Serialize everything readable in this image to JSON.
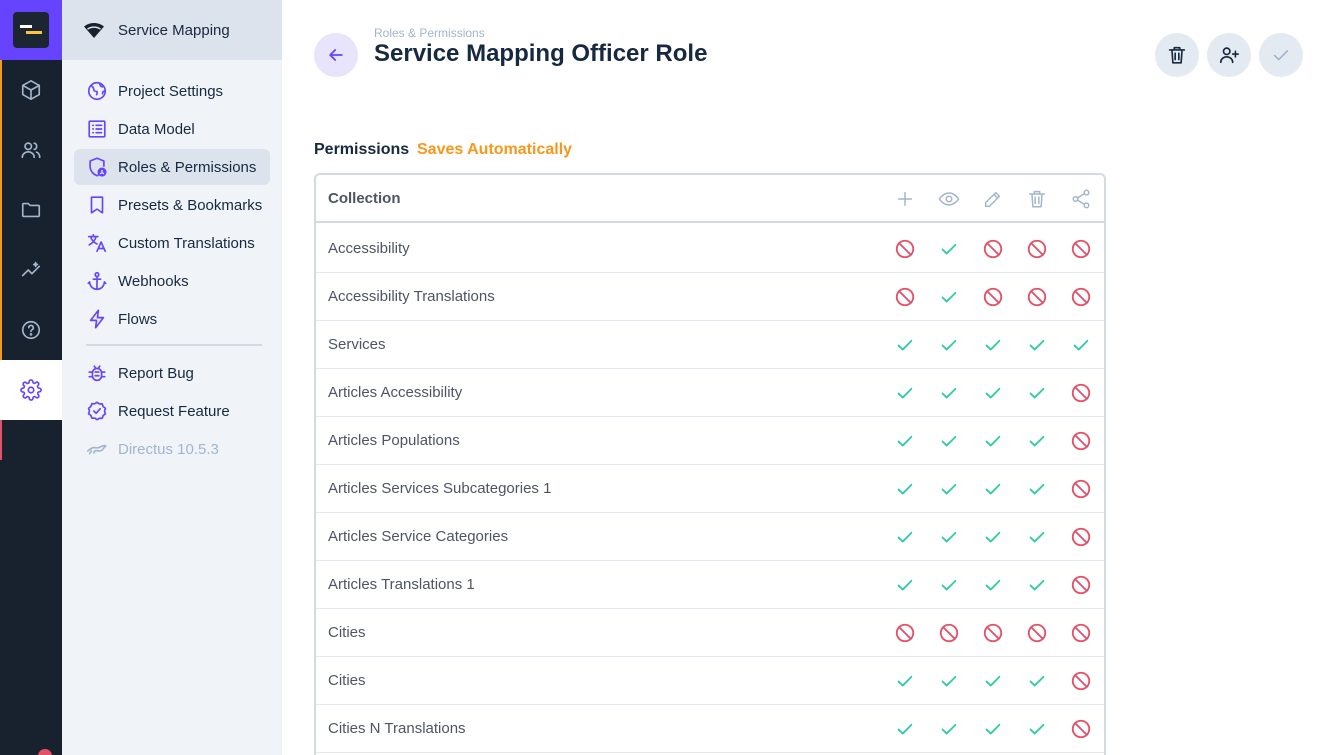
{
  "project": {
    "name": "Service Mapping"
  },
  "modules": [
    {
      "icon": "box-icon"
    },
    {
      "icon": "users-icon"
    },
    {
      "icon": "folder-icon"
    },
    {
      "icon": "insights-icon"
    },
    {
      "icon": "help-icon"
    },
    {
      "icon": "settings-icon"
    }
  ],
  "nav": {
    "items": [
      {
        "label": "Project Settings",
        "icon": "public-icon"
      },
      {
        "label": "Data Model",
        "icon": "list-alt-icon"
      },
      {
        "label": "Roles & Permissions",
        "icon": "admin-user-icon"
      },
      {
        "label": "Presets & Bookmarks",
        "icon": "bookmark-icon"
      },
      {
        "label": "Custom Translations",
        "icon": "translate-icon"
      },
      {
        "label": "Webhooks",
        "icon": "anchor-icon"
      },
      {
        "label": "Flows",
        "icon": "bolt-icon"
      },
      {
        "label": "Report Bug",
        "icon": "bug-icon"
      },
      {
        "label": "Request Feature",
        "icon": "new-releases-icon"
      },
      {
        "label": "Directus 10.5.3",
        "icon": "directus-icon"
      }
    ]
  },
  "header": {
    "breadcrumb": "Roles & Permissions",
    "title": "Service Mapping Officer Role"
  },
  "permissions": {
    "label": "Permissions",
    "note": "Saves Automatically",
    "column_header": "Collection",
    "actions": [
      "create",
      "read",
      "update",
      "delete",
      "share"
    ],
    "rows": [
      {
        "name": "Accessibility",
        "values": [
          "none",
          "all",
          "none",
          "none",
          "none"
        ]
      },
      {
        "name": "Accessibility Translations",
        "values": [
          "none",
          "all",
          "none",
          "none",
          "none"
        ]
      },
      {
        "name": "Services",
        "values": [
          "all",
          "all",
          "all",
          "all",
          "all"
        ]
      },
      {
        "name": "Articles Accessibility",
        "values": [
          "all",
          "all",
          "all",
          "all",
          "none"
        ]
      },
      {
        "name": "Articles Populations",
        "values": [
          "all",
          "all",
          "all",
          "all",
          "none"
        ]
      },
      {
        "name": "Articles Services Subcategories 1",
        "values": [
          "all",
          "all",
          "all",
          "all",
          "none"
        ]
      },
      {
        "name": "Articles Service Categories",
        "values": [
          "all",
          "all",
          "all",
          "all",
          "none"
        ]
      },
      {
        "name": "Articles Translations 1",
        "values": [
          "all",
          "all",
          "all",
          "all",
          "none"
        ]
      },
      {
        "name": "Cities",
        "values": [
          "none",
          "none",
          "none",
          "none",
          "none"
        ]
      },
      {
        "name": "Cities",
        "values": [
          "all",
          "all",
          "all",
          "all",
          "none"
        ]
      },
      {
        "name": "Cities N Translations",
        "values": [
          "all",
          "all",
          "all",
          "all",
          "none"
        ]
      }
    ]
  },
  "colors": {
    "accent": "#6644ff",
    "allowed": "#2ecda7",
    "denied": "#e35169",
    "warning": "#f7971c"
  }
}
